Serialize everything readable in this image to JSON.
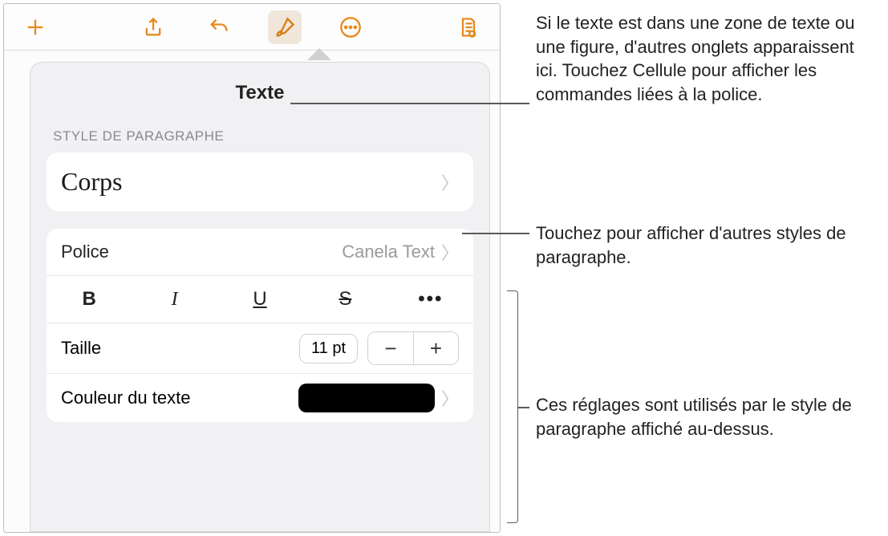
{
  "toolbar": {
    "add": "add",
    "share": "share",
    "undo": "undo",
    "format": "format",
    "more": "more",
    "doc": "document"
  },
  "panel": {
    "title": "Texte",
    "section_style": "STYLE DE PARAGRAPHE",
    "style_name": "Corps",
    "font_label": "Police",
    "font_value": "Canela Text",
    "fmt": {
      "bold": "B",
      "italic": "I",
      "underline": "U",
      "strike": "S",
      "more": "•••"
    },
    "size_label": "Taille",
    "size_value": "11 pt",
    "minus": "−",
    "plus": "+",
    "color_label": "Couleur du texte",
    "color_value": "#000000"
  },
  "annotations": {
    "a1": "Si le texte est dans une zone de texte ou une figure, d'autres onglets apparaissent ici. Touchez Cellule pour afficher les commandes liées à la police.",
    "a2": "Touchez pour afficher d'autres styles de paragraphe.",
    "a3": "Ces réglages sont utilisés par le style de paragraphe affiché au-dessus."
  }
}
